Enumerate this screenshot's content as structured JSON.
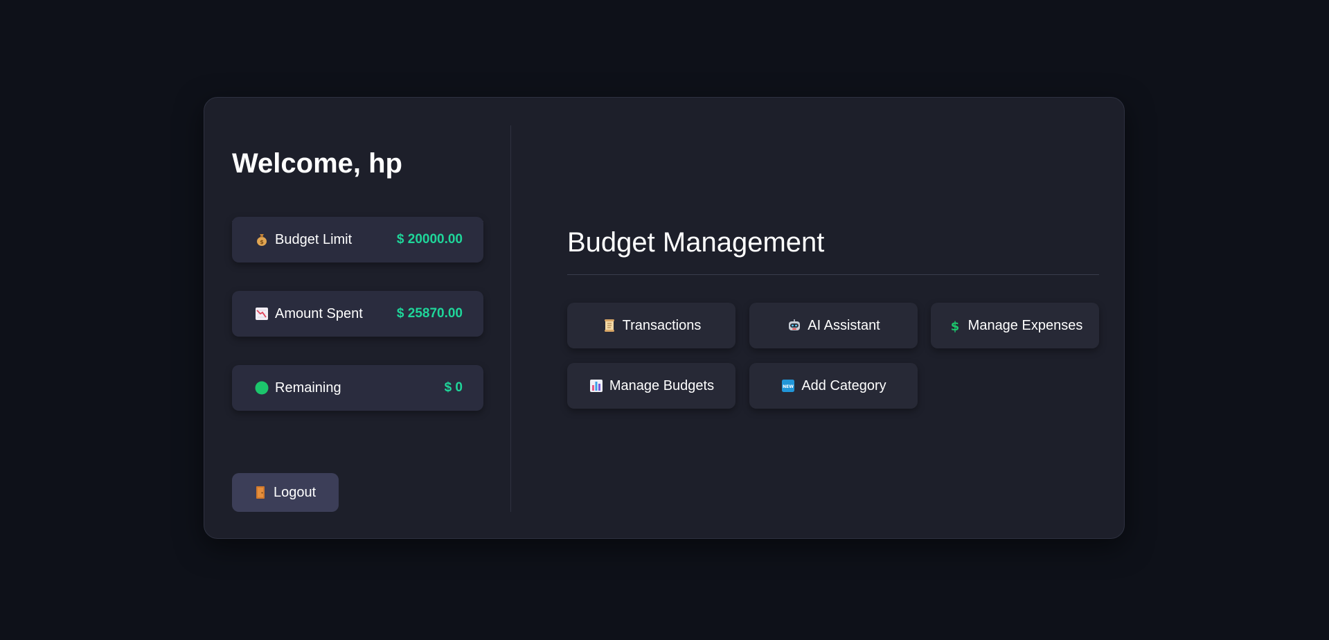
{
  "sidebar": {
    "welcome": "Welcome, hp",
    "stats": [
      {
        "label": "Budget Limit",
        "value": "$ 20000.00",
        "icon": "money-bag-icon"
      },
      {
        "label": "Amount Spent",
        "value": "$ 25870.00",
        "icon": "chart-decreasing-icon"
      },
      {
        "label": "Remaining",
        "value": "$ 0",
        "icon": "green-circle-icon"
      }
    ],
    "logout_label": "Logout",
    "logout_icon": "door-icon"
  },
  "main": {
    "title": "Budget Management",
    "actions": [
      {
        "label": "Transactions",
        "icon": "scroll-icon"
      },
      {
        "label": "AI Assistant",
        "icon": "robot-icon"
      },
      {
        "label": "Manage Expenses",
        "icon": "dollar-sign-icon"
      },
      {
        "label": "Manage Budgets",
        "icon": "bar-chart-icon"
      },
      {
        "label": "Add Category",
        "icon": "new-badge-icon"
      }
    ]
  },
  "colors": {
    "page_background": "#0e1119",
    "card_background": "#1d1f2a",
    "stat_background": "#2a2c3e",
    "value_accent": "#1fd69a",
    "logout_background": "#3c3e58",
    "action_background": "#272936"
  }
}
